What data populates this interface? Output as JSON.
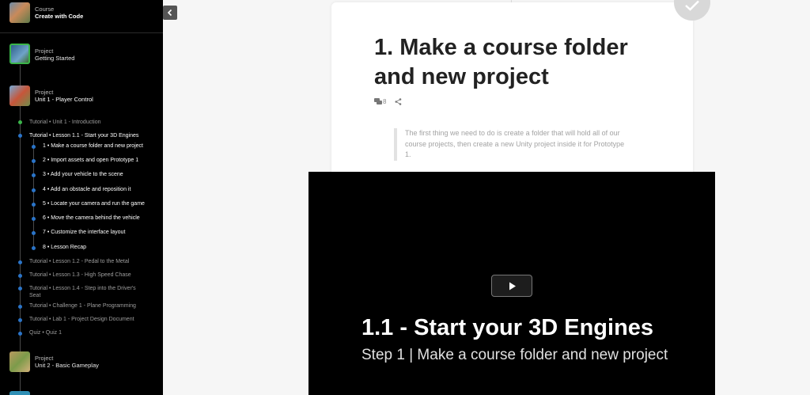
{
  "course": {
    "label": "Course",
    "title": "Create with Code"
  },
  "projects": [
    {
      "label": "Project",
      "title": "Getting Started"
    },
    {
      "label": "Project",
      "title": "Unit 1 - Player Control"
    },
    {
      "label": "Project",
      "title": "Unit 2 - Basic Gameplay"
    }
  ],
  "unit1": {
    "intro": "Tutorial • Unit 1 - Introduction",
    "lesson_1_1": "Tutorial • Lesson 1.1 - Start your 3D Engines",
    "steps": [
      "1 • Make a course folder and new project",
      "2 • Import assets and open Prototype 1",
      "3 • Add your vehicle to the scene",
      "4 • Add an obstacle and reposition it",
      "5 • Locate your camera and run the game",
      "6 • Move the camera behind the vehicle",
      "7 • Customize the interface layout",
      "8 • Lesson Recap"
    ],
    "other": [
      "Tutorial • Lesson 1.2 - Pedal to the Metal",
      "Tutorial • Lesson 1.3 - High Speed Chase",
      "Tutorial • Lesson 1.4 - Step into the Driver's Seat",
      "Tutorial • Challenge 1 - Plane Programming",
      "Tutorial • Lab 1 - Project Design Document",
      "Quiz • Quiz 1"
    ]
  },
  "main": {
    "title": "1. Make a course folder and new project",
    "comment_count": "8",
    "quote": "The first thing we need to do is create a folder that will hold all of our course projects, then create a new Unity project inside it for Prototype 1."
  },
  "video": {
    "title": "1.1 - Start your 3D Engines",
    "subtitle": "Step 1 | Make a course folder and new project"
  },
  "icons": {
    "collapse": "chevron-left-icon",
    "complete": "checkmark-icon",
    "comments": "comments-icon",
    "share": "share-icon",
    "play": "play-icon"
  },
  "colors": {
    "sidebar_bg": "#000000",
    "progress_dot": "#2a74c8",
    "done_dot": "#3bb54a",
    "video_bg": "#000000"
  }
}
